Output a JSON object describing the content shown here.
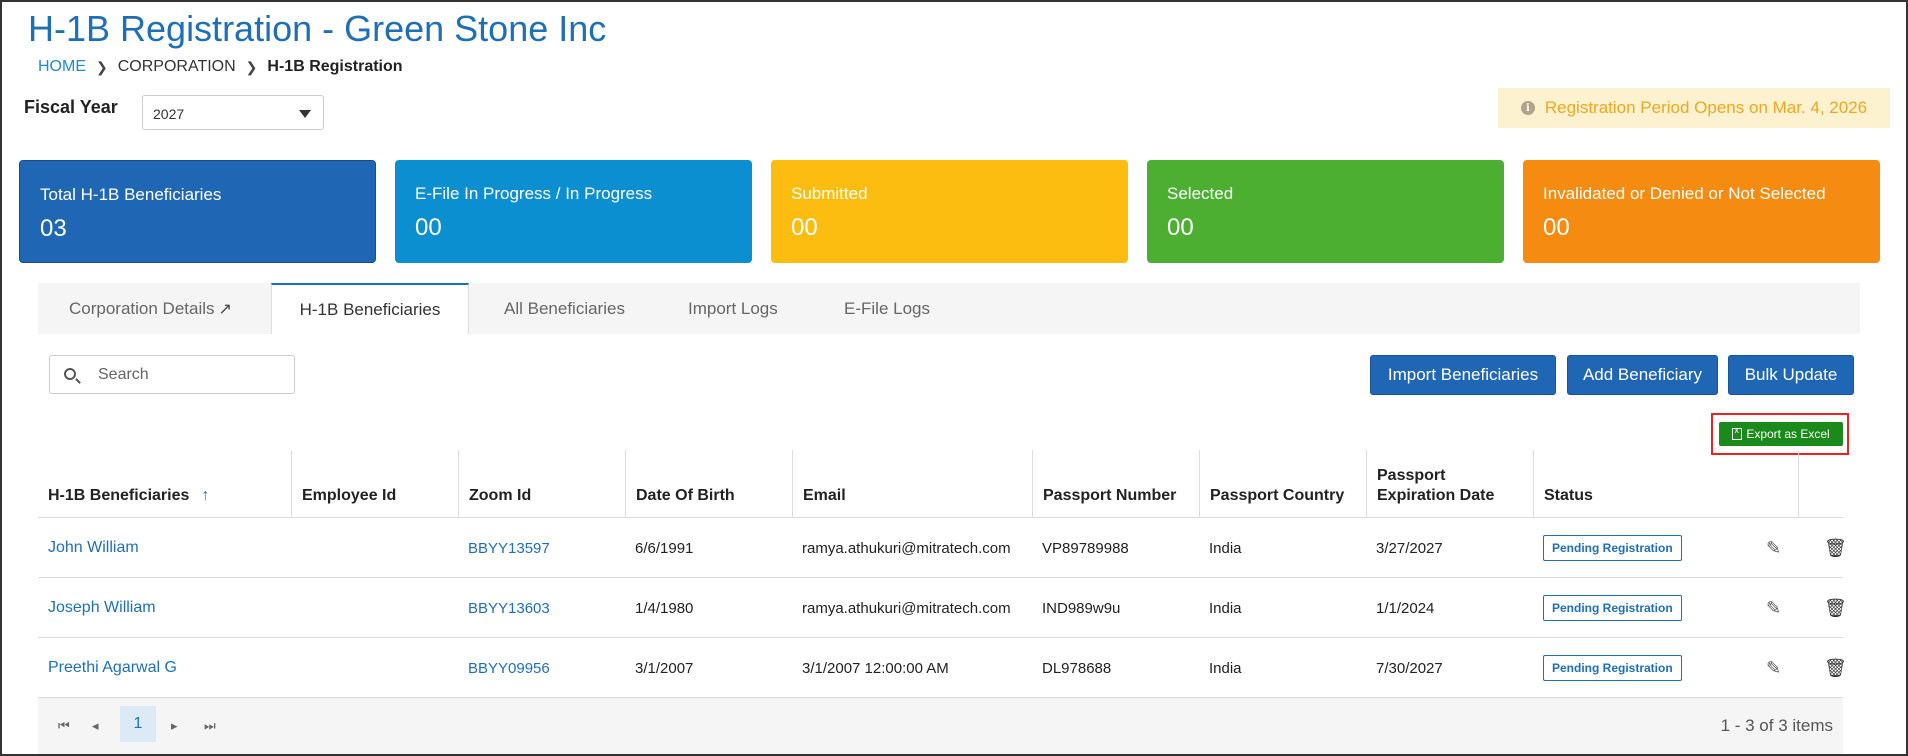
{
  "page": {
    "title": "H-1B Registration - Green Stone Inc"
  },
  "breadcrumb": {
    "home": "HOME",
    "corporation": "CORPORATION",
    "current": "H-1B Registration"
  },
  "fiscal_year": {
    "label": "Fiscal Year",
    "selected": "2027"
  },
  "notice": {
    "text": "Registration Period Opens on Mar. 4, 2026",
    "icon": "info-icon",
    "color": "#f0a71f"
  },
  "cards": [
    {
      "label": "Total H-1B Beneficiaries",
      "value": "03",
      "color": "#1f67b5"
    },
    {
      "label": "E-File In Progress / In Progress",
      "value": "00",
      "color": "#0b8fd0"
    },
    {
      "label": "Submitted",
      "value": "00",
      "color": "#fdbd10"
    },
    {
      "label": "Selected",
      "value": "00",
      "color": "#4caf32"
    },
    {
      "label": "Invalidated or Denied or Not Selected",
      "value": "00",
      "color": "#f68b11"
    }
  ],
  "tabs": [
    {
      "label": "Corporation Details"
    },
    {
      "label": "H-1B Beneficiaries"
    },
    {
      "label": "All Beneficiaries"
    },
    {
      "label": "Import Logs"
    },
    {
      "label": "E-File Logs"
    }
  ],
  "toolbar": {
    "search_placeholder": "Search",
    "import_label": "Import Beneficiaries",
    "add_label": "Add Beneficiary",
    "bulk_label": "Bulk Update",
    "export_label": "Export as Excel"
  },
  "table": {
    "columns": [
      "H-1B Beneficiaries",
      "Employee Id",
      "Zoom Id",
      "Date Of Birth",
      "Email",
      "Passport Number",
      "Passport Country",
      "Passport Expiration Date",
      "Status"
    ],
    "rows": [
      {
        "name": "John William",
        "employee_id": "",
        "zoom_id": "BBYY13597",
        "dob": "6/6/1991",
        "email": "ramya.athukuri@mitratech.com",
        "passport_number": "VP89789988",
        "passport_country": "India",
        "passport_expiration": "3/27/2027",
        "status": "Pending Registration"
      },
      {
        "name": "Joseph William",
        "employee_id": "",
        "zoom_id": "BBYY13603",
        "dob": "1/4/1980",
        "email": "ramya.athukuri@mitratech.com",
        "passport_number": "IND989w9u",
        "passport_country": "India",
        "passport_expiration": "1/1/2024",
        "status": "Pending Registration"
      },
      {
        "name": "Preethi Agarwal G",
        "employee_id": "",
        "zoom_id": "BBYY09956",
        "dob": "3/1/2007",
        "email": "3/1/2007 12:00:00 AM",
        "passport_number": "DL978688",
        "passport_country": "India",
        "passport_expiration": "7/30/2027",
        "status": "Pending Registration"
      }
    ]
  },
  "pager": {
    "current_page": "1",
    "summary": "1 - 3 of 3 items"
  }
}
